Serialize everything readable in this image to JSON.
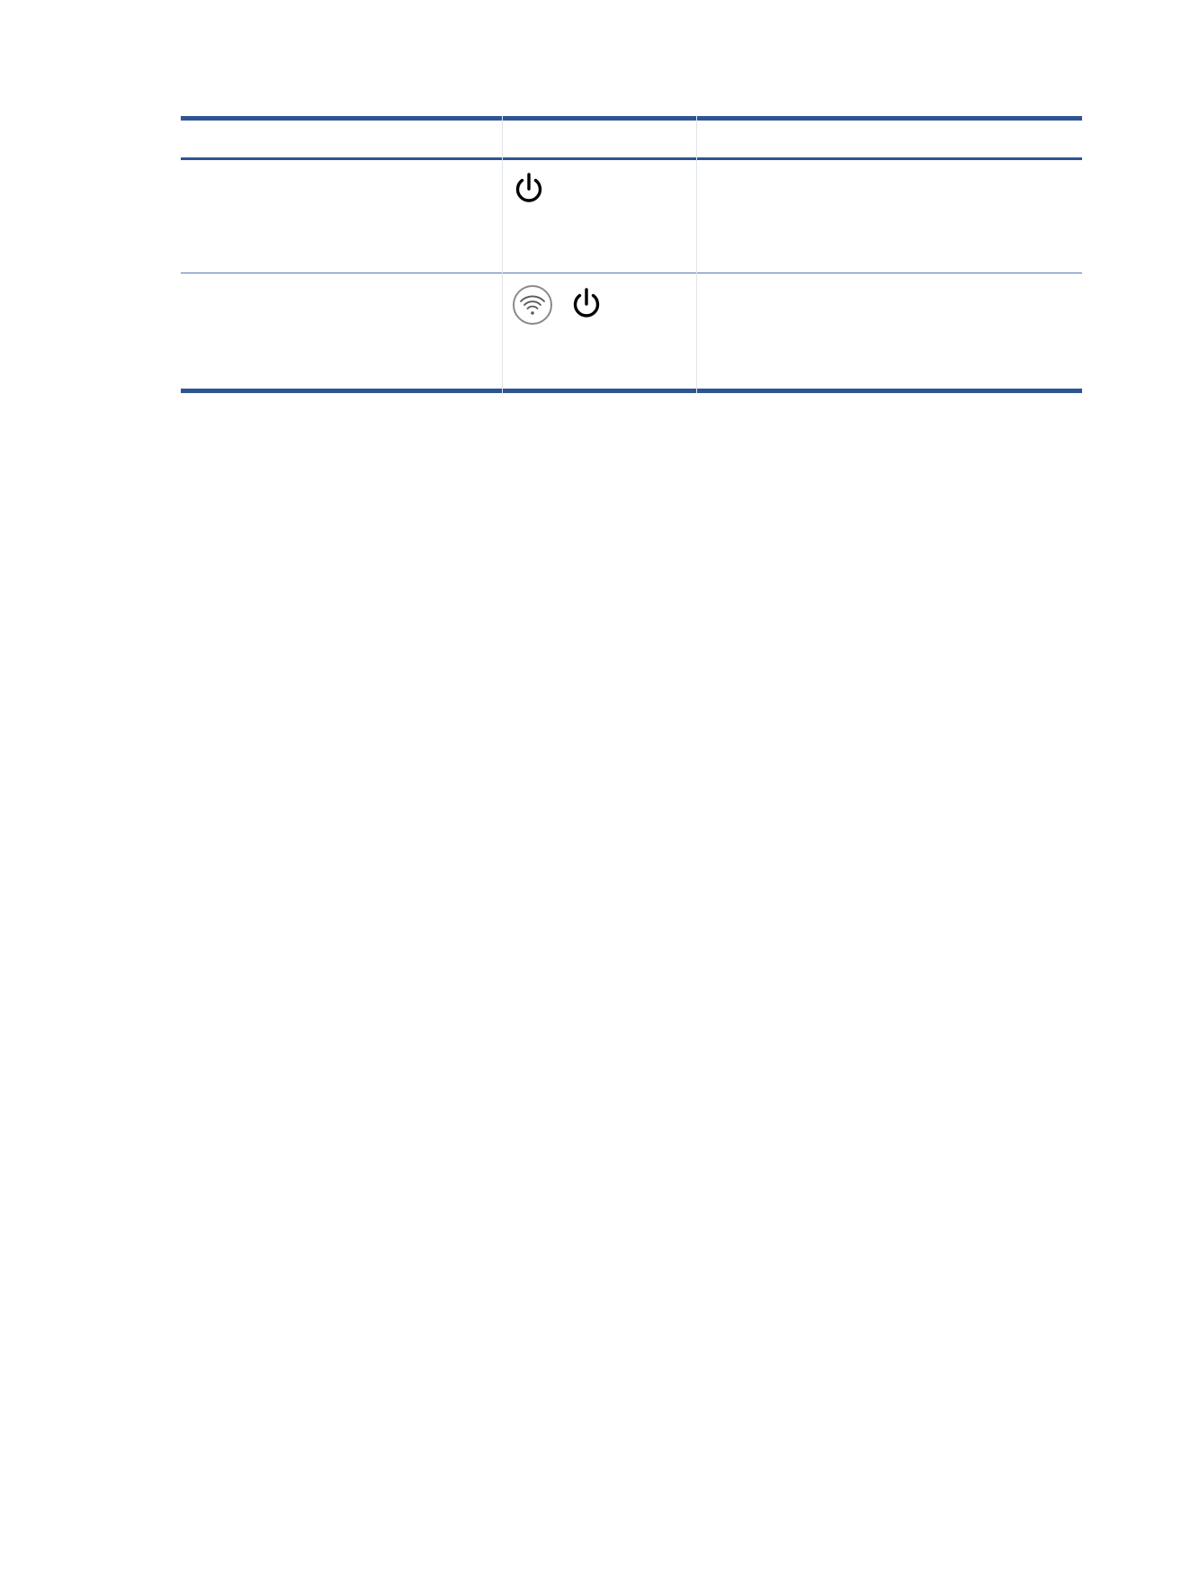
{
  "table": {
    "header": [
      "",
      "",
      ""
    ],
    "rows": [
      {
        "col1": "",
        "icons": [
          "power-icon"
        ],
        "col3": ""
      },
      {
        "col1": "",
        "icons": [
          "wireless-button-icon",
          "power-icon"
        ],
        "col3": ""
      }
    ]
  },
  "colors": {
    "rule": "#2e5592",
    "icon": "#000000",
    "wireless_button_ring": "#8a8a8a"
  }
}
